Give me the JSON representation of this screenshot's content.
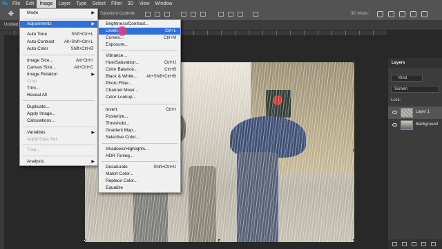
{
  "menubar": {
    "items": [
      "File",
      "Edit",
      "Image",
      "Layer",
      "Type",
      "Select",
      "Filter",
      "3D",
      "View",
      "Window"
    ],
    "active": "Image"
  },
  "options": {
    "transform_label": "Transform Controls",
    "mode_3d": "3D Mode:"
  },
  "doc_tab": {
    "title": "Untitled"
  },
  "image_menu": {
    "items": [
      {
        "label": "Mode",
        "shortcut": "",
        "submenu": true
      },
      {
        "label": "Adjustments",
        "shortcut": "",
        "submenu": true,
        "highlighted": true
      },
      {
        "label": "Auto Tone",
        "shortcut": "Shift+Ctrl+L"
      },
      {
        "label": "Auto Contrast",
        "shortcut": "Alt+Shift+Ctrl+L"
      },
      {
        "label": "Auto Color",
        "shortcut": "Shift+Ctrl+B"
      },
      {
        "label": "Image Size...",
        "shortcut": "Alt+Ctrl+I"
      },
      {
        "label": "Canvas Size...",
        "shortcut": "Alt+Ctrl+C"
      },
      {
        "label": "Image Rotation",
        "shortcut": "",
        "submenu": true
      },
      {
        "label": "Crop",
        "shortcut": "",
        "disabled": true
      },
      {
        "label": "Trim...",
        "shortcut": ""
      },
      {
        "label": "Reveal All",
        "shortcut": ""
      },
      {
        "label": "Duplicate...",
        "shortcut": ""
      },
      {
        "label": "Apply Image...",
        "shortcut": ""
      },
      {
        "label": "Calculations...",
        "shortcut": ""
      },
      {
        "label": "Variables",
        "shortcut": "",
        "submenu": true
      },
      {
        "label": "Apply Data Set...",
        "shortcut": "",
        "disabled": true
      },
      {
        "label": "Trap...",
        "shortcut": "",
        "disabled": true
      },
      {
        "label": "Analysis",
        "shortcut": "",
        "submenu": true
      }
    ]
  },
  "adjustments_menu": {
    "items": [
      {
        "label": "Brightness/Contrast...",
        "shortcut": ""
      },
      {
        "label": "Levels...",
        "shortcut": "Ctrl+L",
        "highlighted": true
      },
      {
        "label": "Curves...",
        "shortcut": "Ctrl+M"
      },
      {
        "label": "Exposure...",
        "shortcut": ""
      },
      {
        "label": "Vibrance...",
        "shortcut": ""
      },
      {
        "label": "Hue/Saturation...",
        "shortcut": "Ctrl+U"
      },
      {
        "label": "Color Balance...",
        "shortcut": "Ctrl+B"
      },
      {
        "label": "Black & White...",
        "shortcut": "Alt+Shift+Ctrl+B"
      },
      {
        "label": "Photo Filter...",
        "shortcut": ""
      },
      {
        "label": "Channel Mixer...",
        "shortcut": ""
      },
      {
        "label": "Color Lookup...",
        "shortcut": ""
      },
      {
        "label": "Invert",
        "shortcut": "Ctrl+I"
      },
      {
        "label": "Posterize...",
        "shortcut": ""
      },
      {
        "label": "Threshold...",
        "shortcut": ""
      },
      {
        "label": "Gradient Map...",
        "shortcut": ""
      },
      {
        "label": "Selective Color...",
        "shortcut": ""
      },
      {
        "label": "Shadows/Highlights...",
        "shortcut": ""
      },
      {
        "label": "HDR Toning...",
        "shortcut": ""
      },
      {
        "label": "Desaturate",
        "shortcut": "Shift+Ctrl+U"
      },
      {
        "label": "Match Color...",
        "shortcut": ""
      },
      {
        "label": "Replace Color...",
        "shortcut": ""
      },
      {
        "label": "Equalize",
        "shortcut": ""
      }
    ]
  },
  "layers_panel": {
    "title": "Layers",
    "filter_kind": "Kind",
    "blend_mode": "Screen",
    "lock_label": "Lock:",
    "layers": [
      {
        "name": "Layer 1",
        "selected": true,
        "italic": false
      },
      {
        "name": "Background",
        "selected": false,
        "italic": true
      }
    ]
  },
  "colors": {
    "menu_highlight": "#2e6fd8",
    "app_bg": "#282828",
    "menubar_bg": "#535353"
  }
}
